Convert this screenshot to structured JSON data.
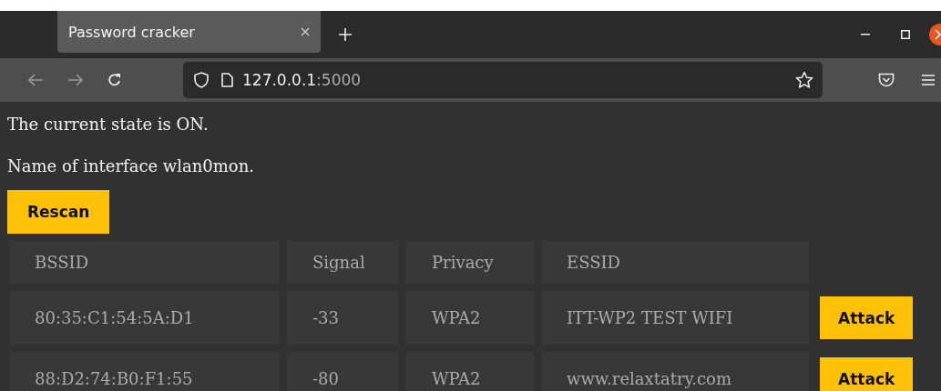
{
  "tab": {
    "title": "Password cracker",
    "selected": true
  },
  "url": {
    "host": "127.0.0.1",
    "port": ":5000"
  },
  "page": {
    "state_text": "The current state is ON.",
    "interface_text": "Name of interface wlan0mon.",
    "rescan_button": "Rescan"
  },
  "table": {
    "columns": [
      "BSSID",
      "Signal",
      "Privacy",
      "ESSID"
    ],
    "rows": [
      {
        "bssid": "80:35:C1:54:5A:D1",
        "signal": "-33",
        "privacy": "WPA2",
        "essid": "ITT-WP2 TEST WIFI",
        "action": "Attack"
      },
      {
        "bssid": "88:D2:74:B0:F1:55",
        "signal": "-80",
        "privacy": "WPA2",
        "essid": "www.relaxtatry.com",
        "action": "Attack"
      }
    ]
  }
}
